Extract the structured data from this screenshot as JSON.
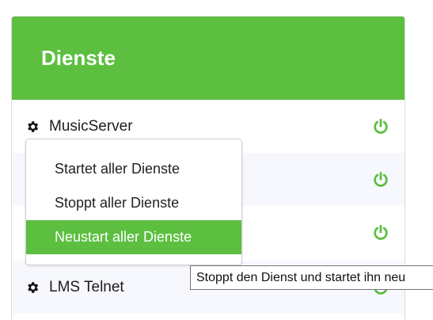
{
  "panel": {
    "title": "Dienste"
  },
  "services": [
    {
      "name": "MusicServer",
      "icon": "gear-icon",
      "action_icon": "power-icon"
    },
    {
      "name": "",
      "icon": "gear-icon",
      "action_icon": "power-icon"
    },
    {
      "name": "",
      "icon": "gear-icon",
      "action_icon": "power-icon"
    },
    {
      "name": "LMS Telnet",
      "icon": "gear-icon",
      "action_icon": "power-icon"
    }
  ],
  "context_menu": {
    "items": [
      {
        "label": "Startet aller Dienste"
      },
      {
        "label": "Stoppt aller Dienste"
      },
      {
        "label": "Neustart aller Dienste",
        "highlighted": true
      }
    ]
  },
  "tooltip": {
    "text": "Stoppt den Dienst und startet ihn neu"
  },
  "colors": {
    "accent": "#5cbf40",
    "row_alt": "#f7f8fd"
  }
}
